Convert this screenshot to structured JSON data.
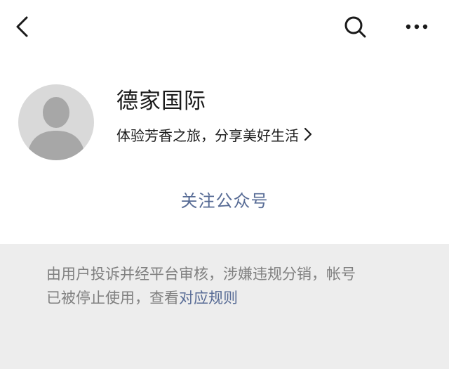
{
  "nav": {
    "back_icon": "chevron-left-icon",
    "search_icon": "search-icon",
    "more_icon": "more-horizontal-icon"
  },
  "profile": {
    "avatar_icon": "default-avatar-icon",
    "name": "德家国际",
    "description": "体验芳香之旅，分享美好生活",
    "chevron_icon": "chevron-right-icon"
  },
  "follow_label": "关注公众号",
  "notice": {
    "line1": "由用户投诉并经平台审核，涉嫌违规分销，帐号",
    "line2_prefix": "已被停止使用，查看",
    "rules_link": "对应规则"
  },
  "colors": {
    "link": "#576b95",
    "notice_bg": "#ededed",
    "notice_text": "#808080",
    "avatar_bg": "#d9d9d9",
    "avatar_fg": "#a7a7a7"
  }
}
